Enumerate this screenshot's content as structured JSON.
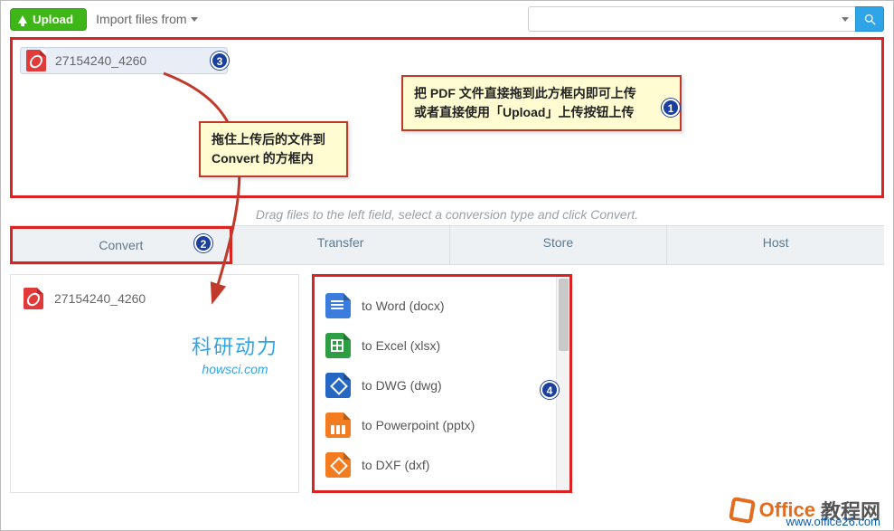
{
  "topbar": {
    "upload_label": "Upload",
    "import_label": "Import files from"
  },
  "uploaded_file": {
    "name": "27154240_4260"
  },
  "hint_text": "Drag files to the left field, select a conversion type and click Convert.",
  "tabs": {
    "convert": "Convert",
    "transfer": "Transfer",
    "store": "Store",
    "host": "Host"
  },
  "convert_panel": {
    "file_name": "27154240_4260",
    "watermark_cn": "科研动力",
    "watermark_en": "howsci.com",
    "options": [
      {
        "id": "word",
        "label": "to Word (docx)"
      },
      {
        "id": "excel",
        "label": "to Excel (xlsx)"
      },
      {
        "id": "dwg",
        "label": "to DWG (dwg)"
      },
      {
        "id": "ppt",
        "label": "to Powerpoint (pptx)"
      },
      {
        "id": "dxf",
        "label": "to DXF (dxf)"
      }
    ]
  },
  "callouts": {
    "a_line1": "把 PDF 文件直接拖到此方框内即可上传",
    "a_line2": "或者直接使用「Upload」上传按钮上传",
    "b_line1": "拖住上传后的文件到",
    "b_line2": "Convert 的方框内"
  },
  "bubbles": {
    "n1": "1",
    "n2": "2",
    "n3": "3",
    "n4": "4"
  },
  "brand": {
    "word1": "Office",
    "word2": "教程网",
    "url": "www.office26.com"
  }
}
